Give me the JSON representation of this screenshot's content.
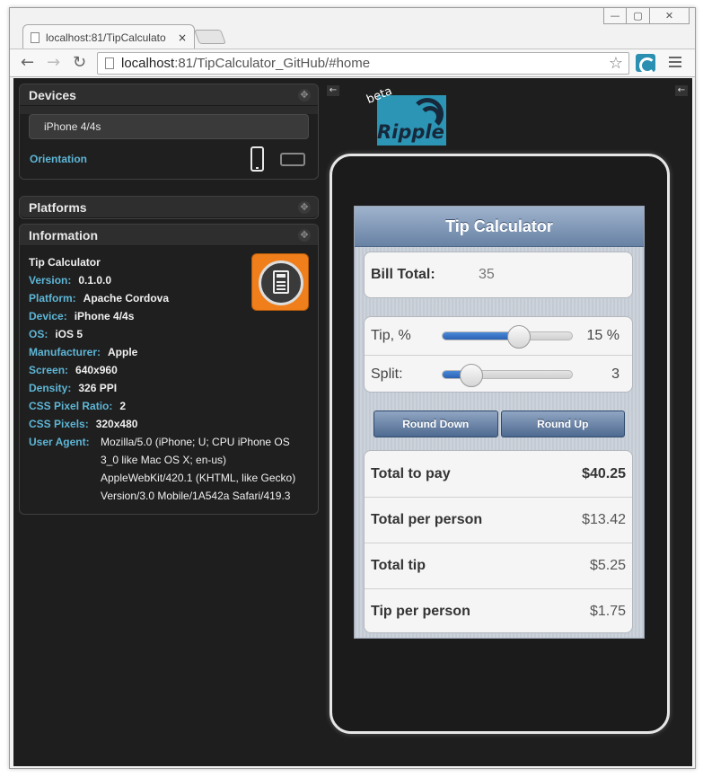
{
  "browser": {
    "tab_title": "localhost:81/TipCalculato",
    "tab_close": "×",
    "url_host": "localhost",
    "url_rest": ":81/TipCalculator_GitHub/#home",
    "back": "←",
    "forward": "→",
    "reload": "↻",
    "star": "☆",
    "window_controls": [
      "—",
      "▢",
      "✕"
    ]
  },
  "devices_panel": {
    "title": "Devices",
    "selected_device": "iPhone 4/4s",
    "orientation_label": "Orientation"
  },
  "platforms_panel": {
    "title": "Platforms"
  },
  "information_panel": {
    "title": "Information",
    "app_name": "Tip Calculator",
    "rows": [
      {
        "key": "Version:",
        "value": "0.1.0.0"
      },
      {
        "key": "Platform:",
        "value": "Apache Cordova"
      },
      {
        "key": "Device:",
        "value": "iPhone 4/4s"
      },
      {
        "key": "OS:",
        "value": "iOS 5"
      },
      {
        "key": "Manufacturer:",
        "value": "Apple"
      },
      {
        "key": "Screen:",
        "value": "640x960"
      },
      {
        "key": "Density:",
        "value": "326 PPI"
      },
      {
        "key": "CSS Pixel Ratio:",
        "value": "2"
      },
      {
        "key": "CSS Pixels:",
        "value": "320x480"
      }
    ],
    "user_agent_key": "User Agent:",
    "user_agent_value": "Mozilla/5.0 (iPhone; U; CPU iPhone OS 3_0 like Mac OS X; en-us) AppleWebKit/420.1 (KHTML, like Gecko) Version/3.0 Mobile/1A542a Safari/419.3"
  },
  "ripple": {
    "logo_text": "Ripple",
    "beta": "beta",
    "collapse": "←"
  },
  "app": {
    "title": "Tip Calculator",
    "bill_label": "Bill Total:",
    "bill_value": "35",
    "tip_label": "Tip, %",
    "tip_value": "15 %",
    "tip_fraction": 0.58,
    "split_label": "Split:",
    "split_value": "3",
    "split_fraction": 0.22,
    "round_down": "Round Down",
    "round_up": "Round Up",
    "totals": [
      {
        "label": "Total to pay",
        "value": "$40.25",
        "strong": true
      },
      {
        "label": "Total per person",
        "value": "$13.42",
        "strong": false
      },
      {
        "label": "Total tip",
        "value": "$5.25",
        "strong": false
      },
      {
        "label": "Tip per person",
        "value": "$1.75",
        "strong": false
      }
    ]
  }
}
